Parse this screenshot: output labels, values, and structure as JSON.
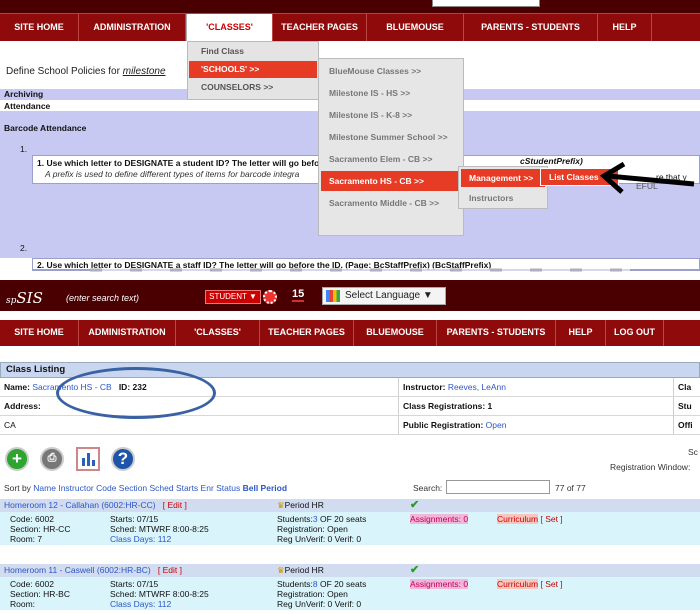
{
  "top": {
    "nav": [
      "SITE HOME",
      "ADMINISTRATION",
      "'CLASSES'",
      "TEACHER PAGES",
      "BLUEMOUSE",
      "PARENTS - STUDENTS",
      "HELP"
    ],
    "policy_title_prefix": "Define School Policies for ",
    "policy_title_school": "milestone",
    "rows": [
      "Archiving",
      "Attendance",
      "Barcode Attendance"
    ],
    "item1_num": "1.",
    "item1_q": "1. Use which letter to DESIGNATE a student ID? The letter will go befo",
    "item1_q_tail": "cStudentPrefix)",
    "item1_desc": "A prefix is used to define different types of items for barcode integra",
    "item1_right": "re that y",
    "item1_right2": "EFUL",
    "item2_num": "2.",
    "item2_q": "2. Use which letter to DESIGNATE a staff ID? The letter will go before the ID. (Page: BcStaffPrefix) (BcStaffPrefix)",
    "menu1": [
      "Find Class",
      "'SCHOOLS' >>",
      "COUNSELORS >>"
    ],
    "menu2": [
      "BlueMouse Classes >>",
      "Milestone IS - HS >>",
      "Milestone IS - K-8 >>",
      "Milestone Summer School >>",
      "Sacramento Elem - CB >>",
      "Sacramento HS - CB >>",
      "Sacramento Middle - CB >>"
    ],
    "menu3": [
      "Management >>",
      "Instructors"
    ],
    "menu4": "List Classes"
  },
  "bottom": {
    "logo": "SIS",
    "logo_prefix": "sp",
    "search_placeholder": "(enter search text)",
    "student_btn": "STUDENT ▼",
    "badge": "15",
    "language": "Select Language ▼",
    "nav": [
      "SITE HOME",
      "ADMINISTRATION",
      "'CLASSES'",
      "TEACHER PAGES",
      "BLUEMOUSE",
      "PARENTS - STUDENTS",
      "HELP",
      "LOG OUT"
    ],
    "class_listing": "Class Listing",
    "name_label": "Name: ",
    "name_value": "Sacramento HS - CB",
    "id_label": "ID: 232",
    "instructor_label": "Instructor: ",
    "instructor_value": "Reeves, LeAnn",
    "cla": "Cla",
    "address_label": "Address:",
    "class_reg": "Class Registrations: 1",
    "stu": "Stu",
    "state": "CA",
    "public_reg_label": "Public Registration: ",
    "public_reg_value": "Open",
    "offi": "Offi",
    "sc": "Sc",
    "reg_window": "Registration Window:",
    "sort_prefix": "Sort by ",
    "sort_links": "Name Instructor Code Section Sched Starts Enr Status",
    "sort_bold": "Bell Period",
    "search_label": "Search:",
    "count": "77 of 77",
    "records": [
      {
        "title": "Homeroom 12 - Callahan (6002:HR-CC)",
        "edit": "[ Edit ]",
        "period": "Period HR",
        "code": "Code: 6002",
        "section": "Section: HR-CC",
        "room": "Room: 7",
        "starts": "Starts: 07/15",
        "sched": "Sched: MTWRF 8:00-8:25",
        "class_days": "Class Days: 112",
        "students_pre": "Students:",
        "students_num": "3",
        "students_post": " OF 20 seats",
        "registration": "Registration: Open",
        "unverif": "Reg UnVerif: 0 Verif: 0",
        "assignments": "Assignments: 0",
        "curriculum": "Curriculum",
        "set": "[ Set ]"
      },
      {
        "title": "Homeroom 11 - Caswell (6002:HR-BC)",
        "edit": "[ Edit ]",
        "period": "Period HR",
        "code": "Code: 6002",
        "section": "Section: HR-BC",
        "room": "Room:",
        "starts": "Starts: 07/15",
        "sched": "Sched: MTWRF 8:00-8:25",
        "class_days": "Class Days: 112",
        "students_pre": "Students:",
        "students_num": "8",
        "students_post": " OF 20 seats",
        "registration": "Registration: Open",
        "unverif": "Reg UnVerif: 0 Verif: 0",
        "assignments": "Assignments: 0",
        "curriculum": "Curriculum",
        "set": "[ Set ]"
      }
    ]
  }
}
